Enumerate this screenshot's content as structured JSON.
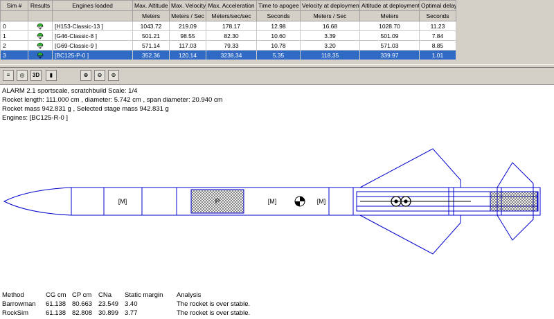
{
  "table": {
    "headers": [
      {
        "top": "Sim #",
        "bottom": ""
      },
      {
        "top": "Results",
        "bottom": ""
      },
      {
        "top": "Engines loaded",
        "bottom": ""
      },
      {
        "top": "Max. Altitude",
        "bottom": "Meters"
      },
      {
        "top": "Max. Velocity",
        "bottom": "Meters / Sec"
      },
      {
        "top": "Max. Acceleration",
        "bottom": "Meters/sec/sec"
      },
      {
        "top": "Time to apogee",
        "bottom": "Seconds"
      },
      {
        "top": "Velocity at deployment",
        "bottom": "Meters / Sec"
      },
      {
        "top": "Altitude at deployment",
        "bottom": "Meters"
      },
      {
        "top": "Optimal delay",
        "bottom": "Seconds"
      }
    ],
    "rows": [
      {
        "sim": "0",
        "engine": "[H153-Classic-13  ]",
        "alt": "1043.72",
        "vel": "219.09",
        "acc": "178.17",
        "apogee": "12.98",
        "vdep": "16.68",
        "adep": "1028.70",
        "delay": "11.23",
        "selected": false
      },
      {
        "sim": "1",
        "engine": "[G46-Classic-8  ]",
        "alt": "501.21",
        "vel": "98.55",
        "acc": "82.30",
        "apogee": "10.60",
        "vdep": "3.39",
        "adep": "501.09",
        "delay": "7.84",
        "selected": false
      },
      {
        "sim": "2",
        "engine": "[G69-Classic-9  ]",
        "alt": "571.14",
        "vel": "117.03",
        "acc": "79.33",
        "apogee": "10.78",
        "vdep": "3.20",
        "adep": "571.03",
        "delay": "8.85",
        "selected": false
      },
      {
        "sim": "3",
        "engine": "[BC125-P-0  ]",
        "alt": "352.36",
        "vel": "120.14",
        "acc": "3238.34",
        "apogee": "5.35",
        "vdep": "118.35",
        "adep": "339.97",
        "delay": "1.01",
        "selected": true
      }
    ]
  },
  "toolbar": {
    "buttons": [
      {
        "name": "cg-view-icon",
        "glyph": "≡"
      },
      {
        "name": "target-view-icon",
        "glyph": "◎"
      },
      {
        "name": "3d-view-button",
        "glyph": "3D"
      },
      {
        "name": "rocket-view-icon",
        "glyph": "▮"
      },
      {
        "name": "zoom-in-icon",
        "glyph": "⊕"
      },
      {
        "name": "zoom-out-icon",
        "glyph": "⊖"
      },
      {
        "name": "zoom-fit-icon",
        "glyph": "⊙"
      }
    ]
  },
  "info": {
    "line1": "ALARM 2.1 sportscale, scratchbuild   Scale: 1/4",
    "line2": "Rocket length: 111.000  cm , diameter: 5.742  cm , span diameter: 20.940  cm",
    "line3": "Rocket mass 942.831 g , Selected stage mass 942.831 g",
    "line4": "Engines: [BC125-R-0   ]"
  },
  "diagram": {
    "mass_labels": [
      "[M]",
      "[M]",
      "[M]"
    ],
    "parachute_label": "P"
  },
  "analysis": {
    "headers": [
      "Method",
      "CG cm",
      "CP cm",
      "CNa",
      "Static margin",
      "Analysis"
    ],
    "rows": [
      [
        "Barrowman",
        "61.138",
        "80.663",
        "23.549",
        "3.40",
        "The rocket is over stable."
      ],
      [
        "RockSim",
        "61.138",
        "82.808",
        "30.899",
        "3.77",
        "The rocket is over stable."
      ]
    ]
  },
  "colors": {
    "accent": "#316ac5",
    "outline": "#0000cc",
    "pale": "#bfbfff",
    "chute": "#2fbf2f"
  }
}
